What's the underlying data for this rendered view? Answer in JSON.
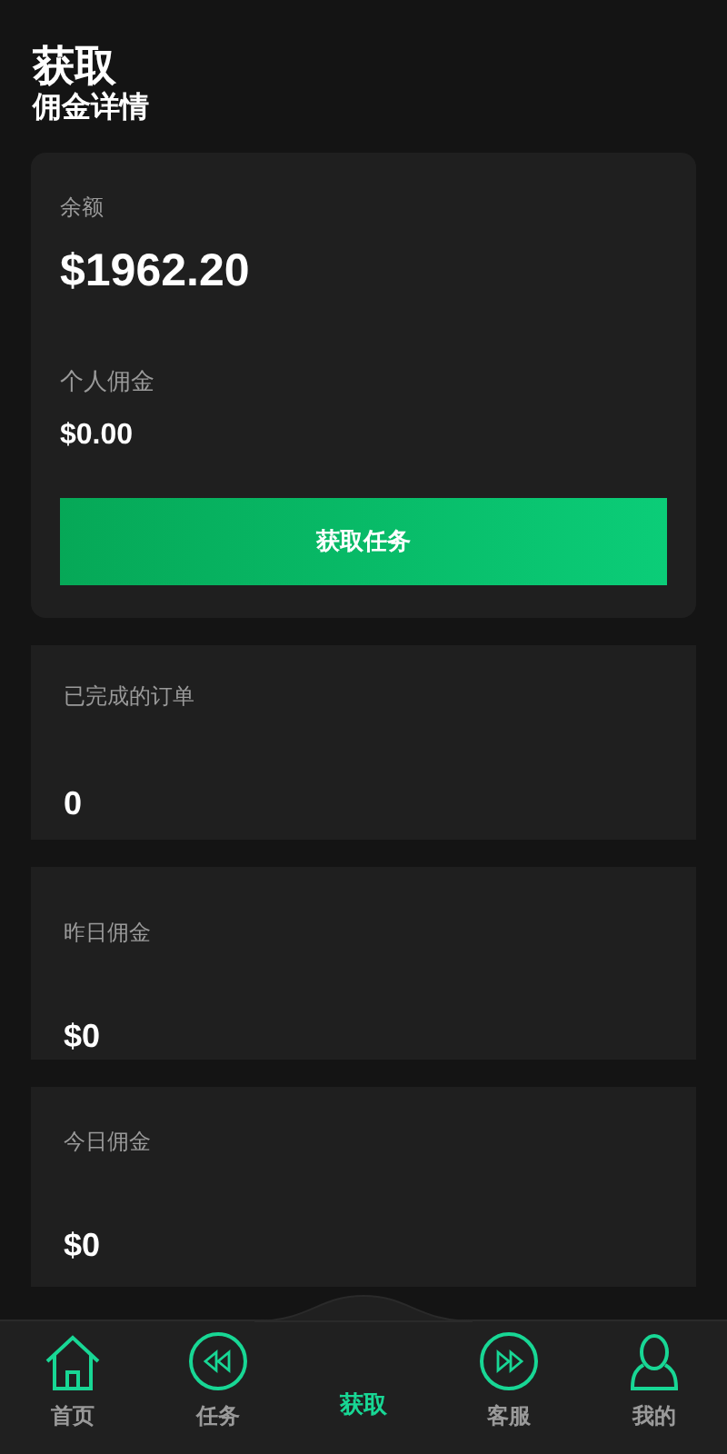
{
  "header": {
    "title": "获取",
    "subtitle": "佣金详情"
  },
  "balance_card": {
    "balance_label": "余额",
    "balance": "$1962.20",
    "commission_label": "个人佣金",
    "commission": "$0.00",
    "button": "获取任务"
  },
  "stats": [
    {
      "label": "已完成的订单",
      "value": "0"
    },
    {
      "label": "昨日佣金",
      "value": "$0"
    },
    {
      "label": "今日佣金",
      "value": "$0"
    }
  ],
  "nav": [
    {
      "kind": "home",
      "label": "首页",
      "selected": false
    },
    {
      "kind": "rewind",
      "label": "任务",
      "selected": false
    },
    {
      "kind": "center",
      "label": "获取",
      "selected": true
    },
    {
      "kind": "forward",
      "label": "客服",
      "selected": false
    },
    {
      "kind": "person",
      "label": "我的",
      "selected": false
    }
  ]
}
